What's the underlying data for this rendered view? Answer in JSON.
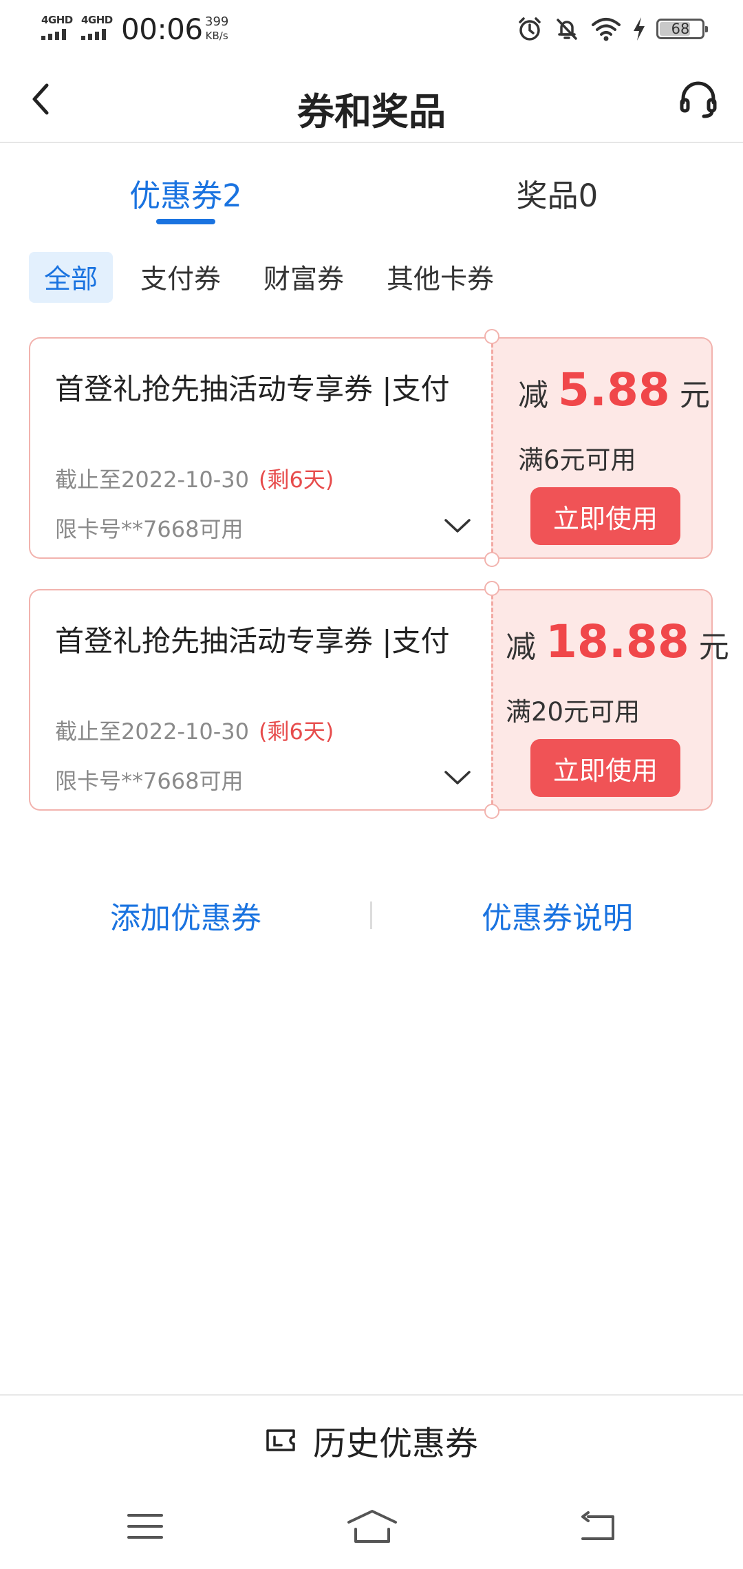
{
  "status_bar": {
    "network_1": "4GHD",
    "network_2": "4GHD",
    "time": "00:06",
    "speed_value": "399",
    "speed_unit": "KB/s",
    "battery": "68",
    "icons": [
      "alarm-icon",
      "mute-bell-icon",
      "wifi-icon",
      "charging-icon",
      "battery-icon"
    ]
  },
  "header": {
    "title": "券和奖品",
    "back_icon": "chevron-left-icon",
    "service_icon": "headset-icon"
  },
  "tabs": [
    {
      "label": "优惠券2",
      "active": true
    },
    {
      "label": "奖品0",
      "active": false
    }
  ],
  "filters": [
    {
      "label": "全部",
      "active": true
    },
    {
      "label": "支付券",
      "active": false
    },
    {
      "label": "财富券",
      "active": false
    },
    {
      "label": "其他卡券",
      "active": false
    }
  ],
  "coupons": [
    {
      "title": "首登礼抢先抽活动专享券 |支付",
      "expiry": "截止至2022-10-30",
      "remaining": "(剩6天)",
      "card_limit": "限卡号**7668可用",
      "discount_prefix": "减",
      "amount": "5.88",
      "unit": "元",
      "threshold": "满6元可用",
      "button": "立即使用"
    },
    {
      "title": "首登礼抢先抽活动专享券 |支付",
      "expiry": "截止至2022-10-30",
      "remaining": "(剩6天)",
      "card_limit": "限卡号**7668可用",
      "discount_prefix": "减",
      "amount": "18.88",
      "unit": "元",
      "threshold": "满20元可用",
      "button": "立即使用"
    }
  ],
  "links": {
    "add": "添加优惠券",
    "explain": "优惠券说明"
  },
  "history": {
    "label": "历史优惠券",
    "icon": "ticket-icon"
  },
  "nav": {
    "icons": [
      "menu-icon",
      "home-icon",
      "back-icon"
    ]
  },
  "colors": {
    "accent_blue": "#1a73e0",
    "coupon_red": "#f0474a",
    "coupon_bg": "#fde8e6",
    "button_red": "#f05356"
  }
}
